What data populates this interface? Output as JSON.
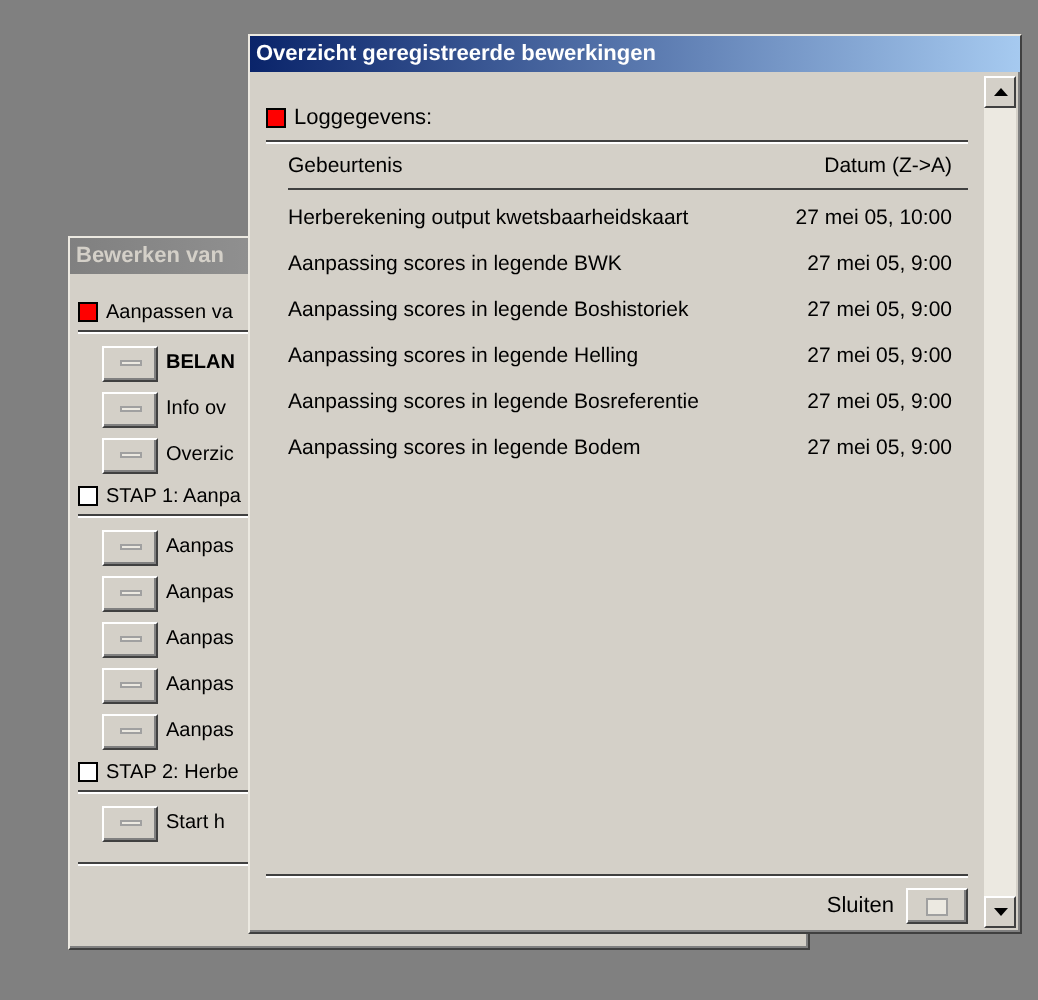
{
  "back_window": {
    "title": "Bewerken van",
    "sections": [
      {
        "label": "Aanpassen va",
        "active": true,
        "items": [
          {
            "label": "BELAN",
            "bold": true
          },
          {
            "label": "Info ov",
            "bold": false
          },
          {
            "label": "Overzic",
            "bold": false
          }
        ]
      },
      {
        "label": "STAP 1: Aanpa",
        "active": false,
        "items": [
          {
            "label": "Aanpas",
            "bold": false
          },
          {
            "label": "Aanpas",
            "bold": false
          },
          {
            "label": "Aanpas",
            "bold": false
          },
          {
            "label": "Aanpas",
            "bold": false
          },
          {
            "label": "Aanpas",
            "bold": false
          }
        ]
      },
      {
        "label": "STAP 2: Herbe",
        "active": false,
        "items": [
          {
            "label": "Start h",
            "bold": false
          }
        ]
      }
    ]
  },
  "front_window": {
    "title": "Overzicht geregistreerde bewerkingen",
    "section": {
      "label": "Loggegevens:",
      "active": true
    },
    "table": {
      "columns": [
        "Gebeurtenis",
        "Datum (Z->A)"
      ],
      "rows": [
        [
          "Herberekening output kwetsbaarheidskaart",
          "27 mei 05, 10:00"
        ],
        [
          "Aanpassing scores in legende BWK",
          "27 mei 05, 9:00"
        ],
        [
          "Aanpassing scores in legende Boshistoriek",
          "27 mei 05, 9:00"
        ],
        [
          "Aanpassing scores in legende Helling",
          "27 mei 05, 9:00"
        ],
        [
          "Aanpassing scores in legende Bosreferentie",
          "27 mei 05, 9:00"
        ],
        [
          "Aanpassing scores in legende Bodem",
          "27 mei 05, 9:00"
        ]
      ]
    },
    "close_label": "Sluiten"
  }
}
